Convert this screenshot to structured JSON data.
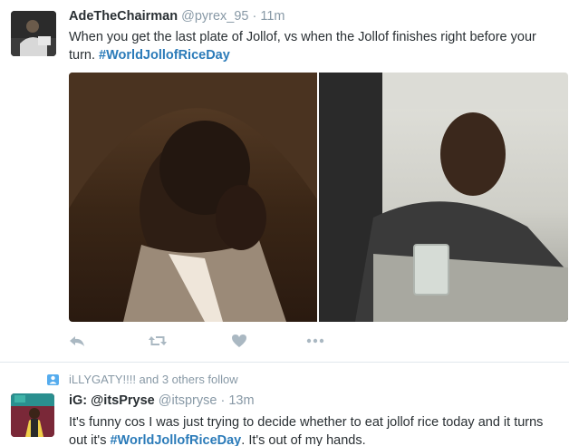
{
  "tweets": [
    {
      "fullname": "AdeTheChairman",
      "handle": "@pyrex_95",
      "separator": "·",
      "time": "11m",
      "text_before": "When you get the last plate of Jollof, vs when the Jollof finishes right before your turn. ",
      "hashtag": "#WorldJollofRiceDay",
      "text_after": ""
    },
    {
      "fullname": "iG: @itsPryse",
      "handle": "@itspryse",
      "separator": "·",
      "time": "13m",
      "text_before": "It's funny cos I was just trying to decide whether to eat jollof rice today and it turns out it's ",
      "hashtag": "#WorldJollofRiceDay",
      "text_after": ". It's out of my hands."
    }
  ],
  "follow_context": {
    "text": "iLLYGATY!!!! and 3 others follow",
    "icon": "person-follow-icon"
  },
  "actions": {
    "reply_icon": "reply-icon",
    "retweet_icon": "retweet-icon",
    "like_icon": "heart-icon",
    "more_icon": "more-dots-icon"
  },
  "colors": {
    "link": "#2b7bb9",
    "meta": "#8899a6",
    "action": "#aab8c2",
    "text": "#292f33"
  }
}
